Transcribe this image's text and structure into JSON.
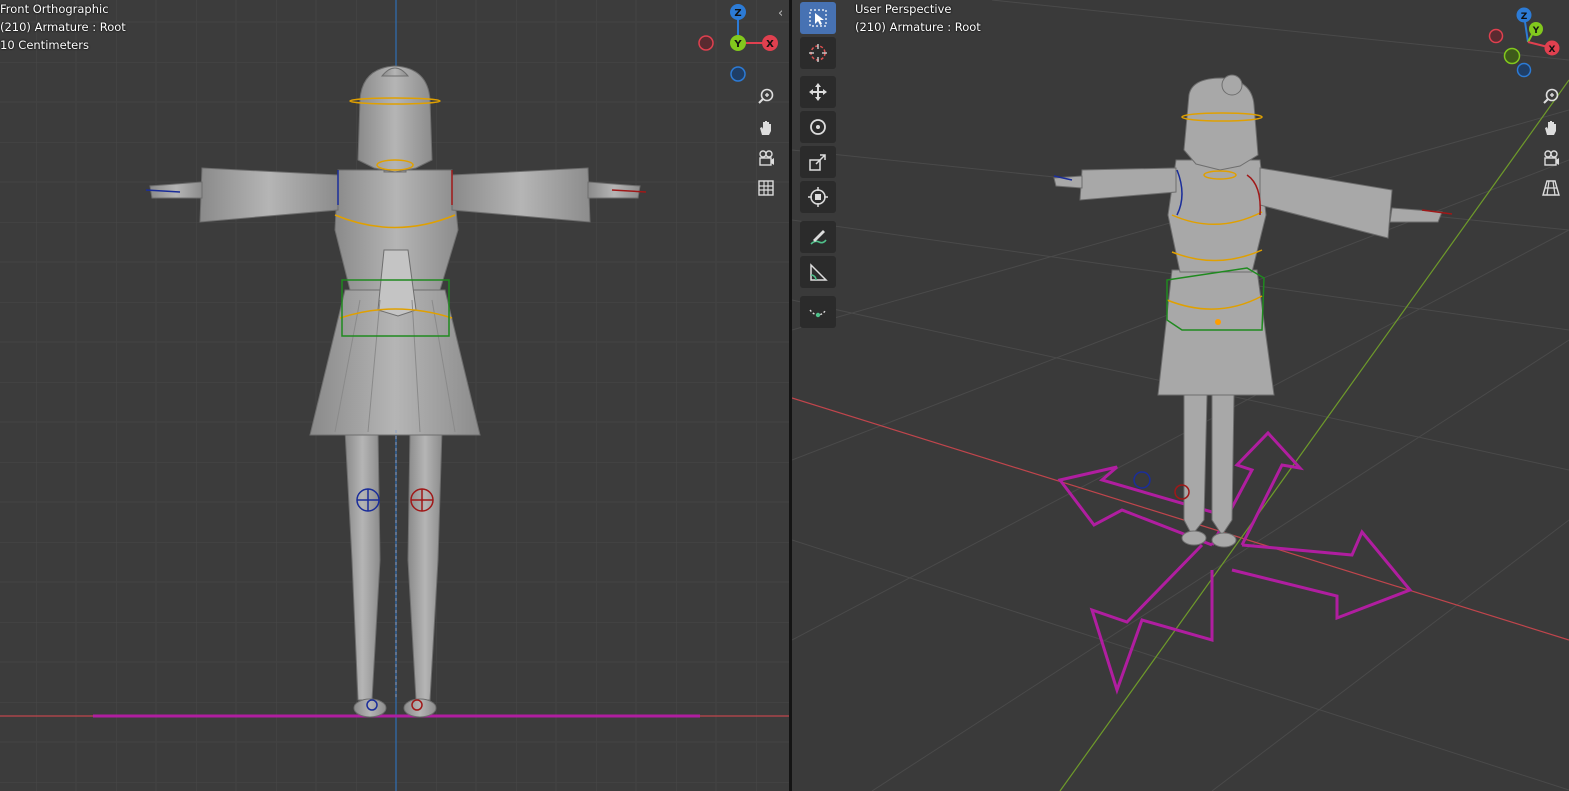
{
  "left_viewport": {
    "view_name": "Front Orthographic",
    "object_info": "(210) Armature : Root",
    "grid_scale": "10 Centimeters"
  },
  "right_viewport": {
    "view_name": "User Perspective",
    "object_info": "(210) Armature : Root"
  },
  "gizmo": {
    "left_axes": [
      "Z",
      "Y",
      "X"
    ],
    "right_axes": [
      "Z",
      "Y",
      "X"
    ]
  },
  "nav_icons": [
    "zoom-icon",
    "hand-pan-icon",
    "camera-icon",
    "grid-toggle-icon"
  ],
  "tools": [
    "select-box-icon",
    "cursor-icon",
    "move-icon",
    "rotate-icon",
    "scale-icon",
    "transform-icon",
    "annotate-icon",
    "measure-icon",
    "roll-icon"
  ],
  "colors": {
    "viewport_bg": "#3c3c3c",
    "active_tool": "#4772b3",
    "axis_x": "#e0404f",
    "axis_y": "#82c81d",
    "axis_z": "#2c7bd6",
    "bone_selected": "#ff9e00",
    "control_magenta": "#b01ea0"
  }
}
